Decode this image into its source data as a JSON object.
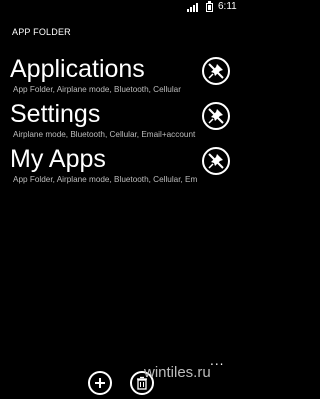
{
  "status_bar": {
    "time": "6:11"
  },
  "header": {
    "title": "APP FOLDER"
  },
  "folders": [
    {
      "title": "Applications",
      "subtitle": "App Folder, Airplane mode, Bluetooth, Cellular"
    },
    {
      "title": "Settings",
      "subtitle": "Airplane mode, Bluetooth, Cellular, Email+account"
    },
    {
      "title": "My Apps",
      "subtitle": "App Folder, Airplane mode, Bluetooth, Cellular, Em"
    }
  ],
  "app_bar": {
    "more": "..."
  },
  "watermark": "wintiles.ru"
}
